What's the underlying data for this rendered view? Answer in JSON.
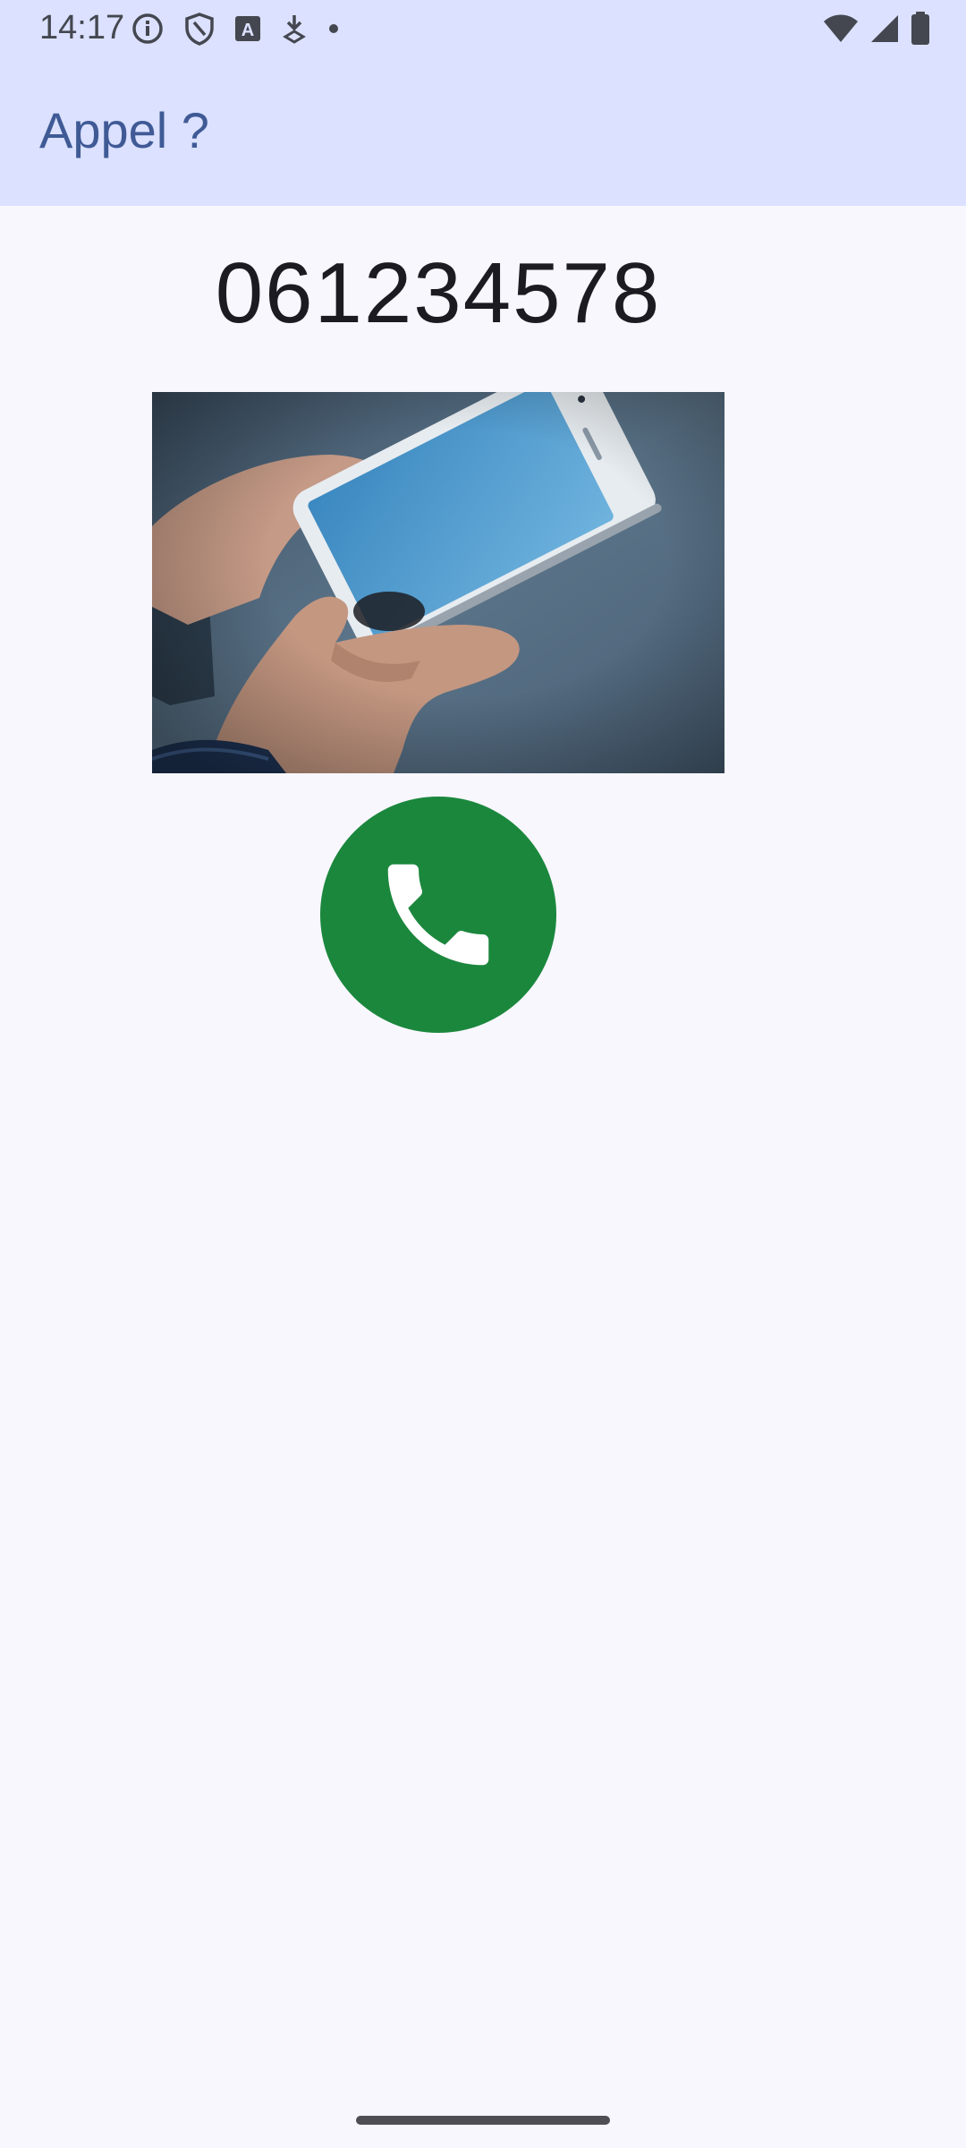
{
  "status_bar": {
    "time": "14:17",
    "left_icons": [
      "info-icon",
      "shield-icon",
      "font-a-icon",
      "download-arrow-icon",
      "dot-icon"
    ],
    "right_icons": [
      "wifi-icon",
      "cellular-signal-icon",
      "battery-icon"
    ]
  },
  "app_bar": {
    "title": "Appel ?"
  },
  "call": {
    "number": "061234578",
    "photo_icon": "hands-holding-smartphone-photo",
    "call_button_icon": "phone-handset-icon",
    "call_button_color": "#1b873d"
  },
  "colors": {
    "app_bar_background": "#dbe1ff",
    "title_color": "#3f5a95",
    "page_background": "#f7f7fd"
  }
}
